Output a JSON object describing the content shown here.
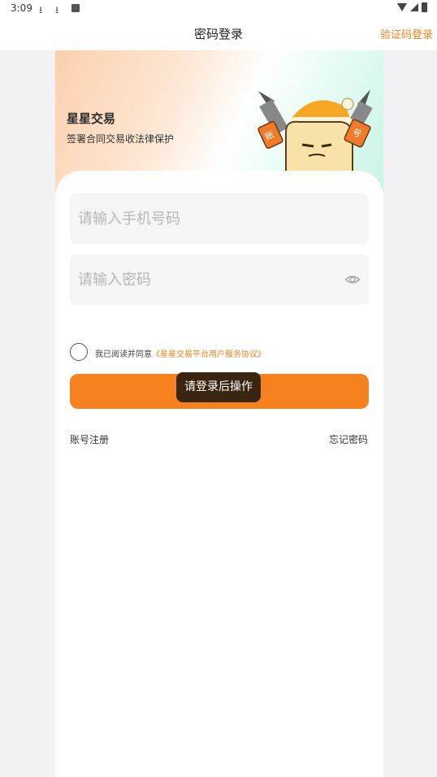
{
  "status_bar": {
    "time": "3:09",
    "icons": [
      "download-icon",
      "download-icon",
      "notification-box-icon",
      "wifi-icon",
      "signal-icon",
      "battery-icon"
    ]
  },
  "nav": {
    "title": "密码登录",
    "action": "验证码登录"
  },
  "banner": {
    "title": "星星交易",
    "subtitle": "签署合同交易收法律保护",
    "mascot_tag_left": "账",
    "mascot_tag_right": "号"
  },
  "form": {
    "phone_placeholder": "请输入手机号码",
    "password_placeholder": "请输入密码",
    "agree_prefix": "我已阅读并同意",
    "agree_link": "《星星交易平台用户服务协议》",
    "login_button": "",
    "toast": "请登录后操作",
    "register": "账号注册",
    "forgot": "忘记密码"
  },
  "colors": {
    "accent": "#f5821f",
    "toast_bg": "#3a2510",
    "page_bg": "#f2f2f4",
    "input_bg": "#f5f5f6"
  }
}
